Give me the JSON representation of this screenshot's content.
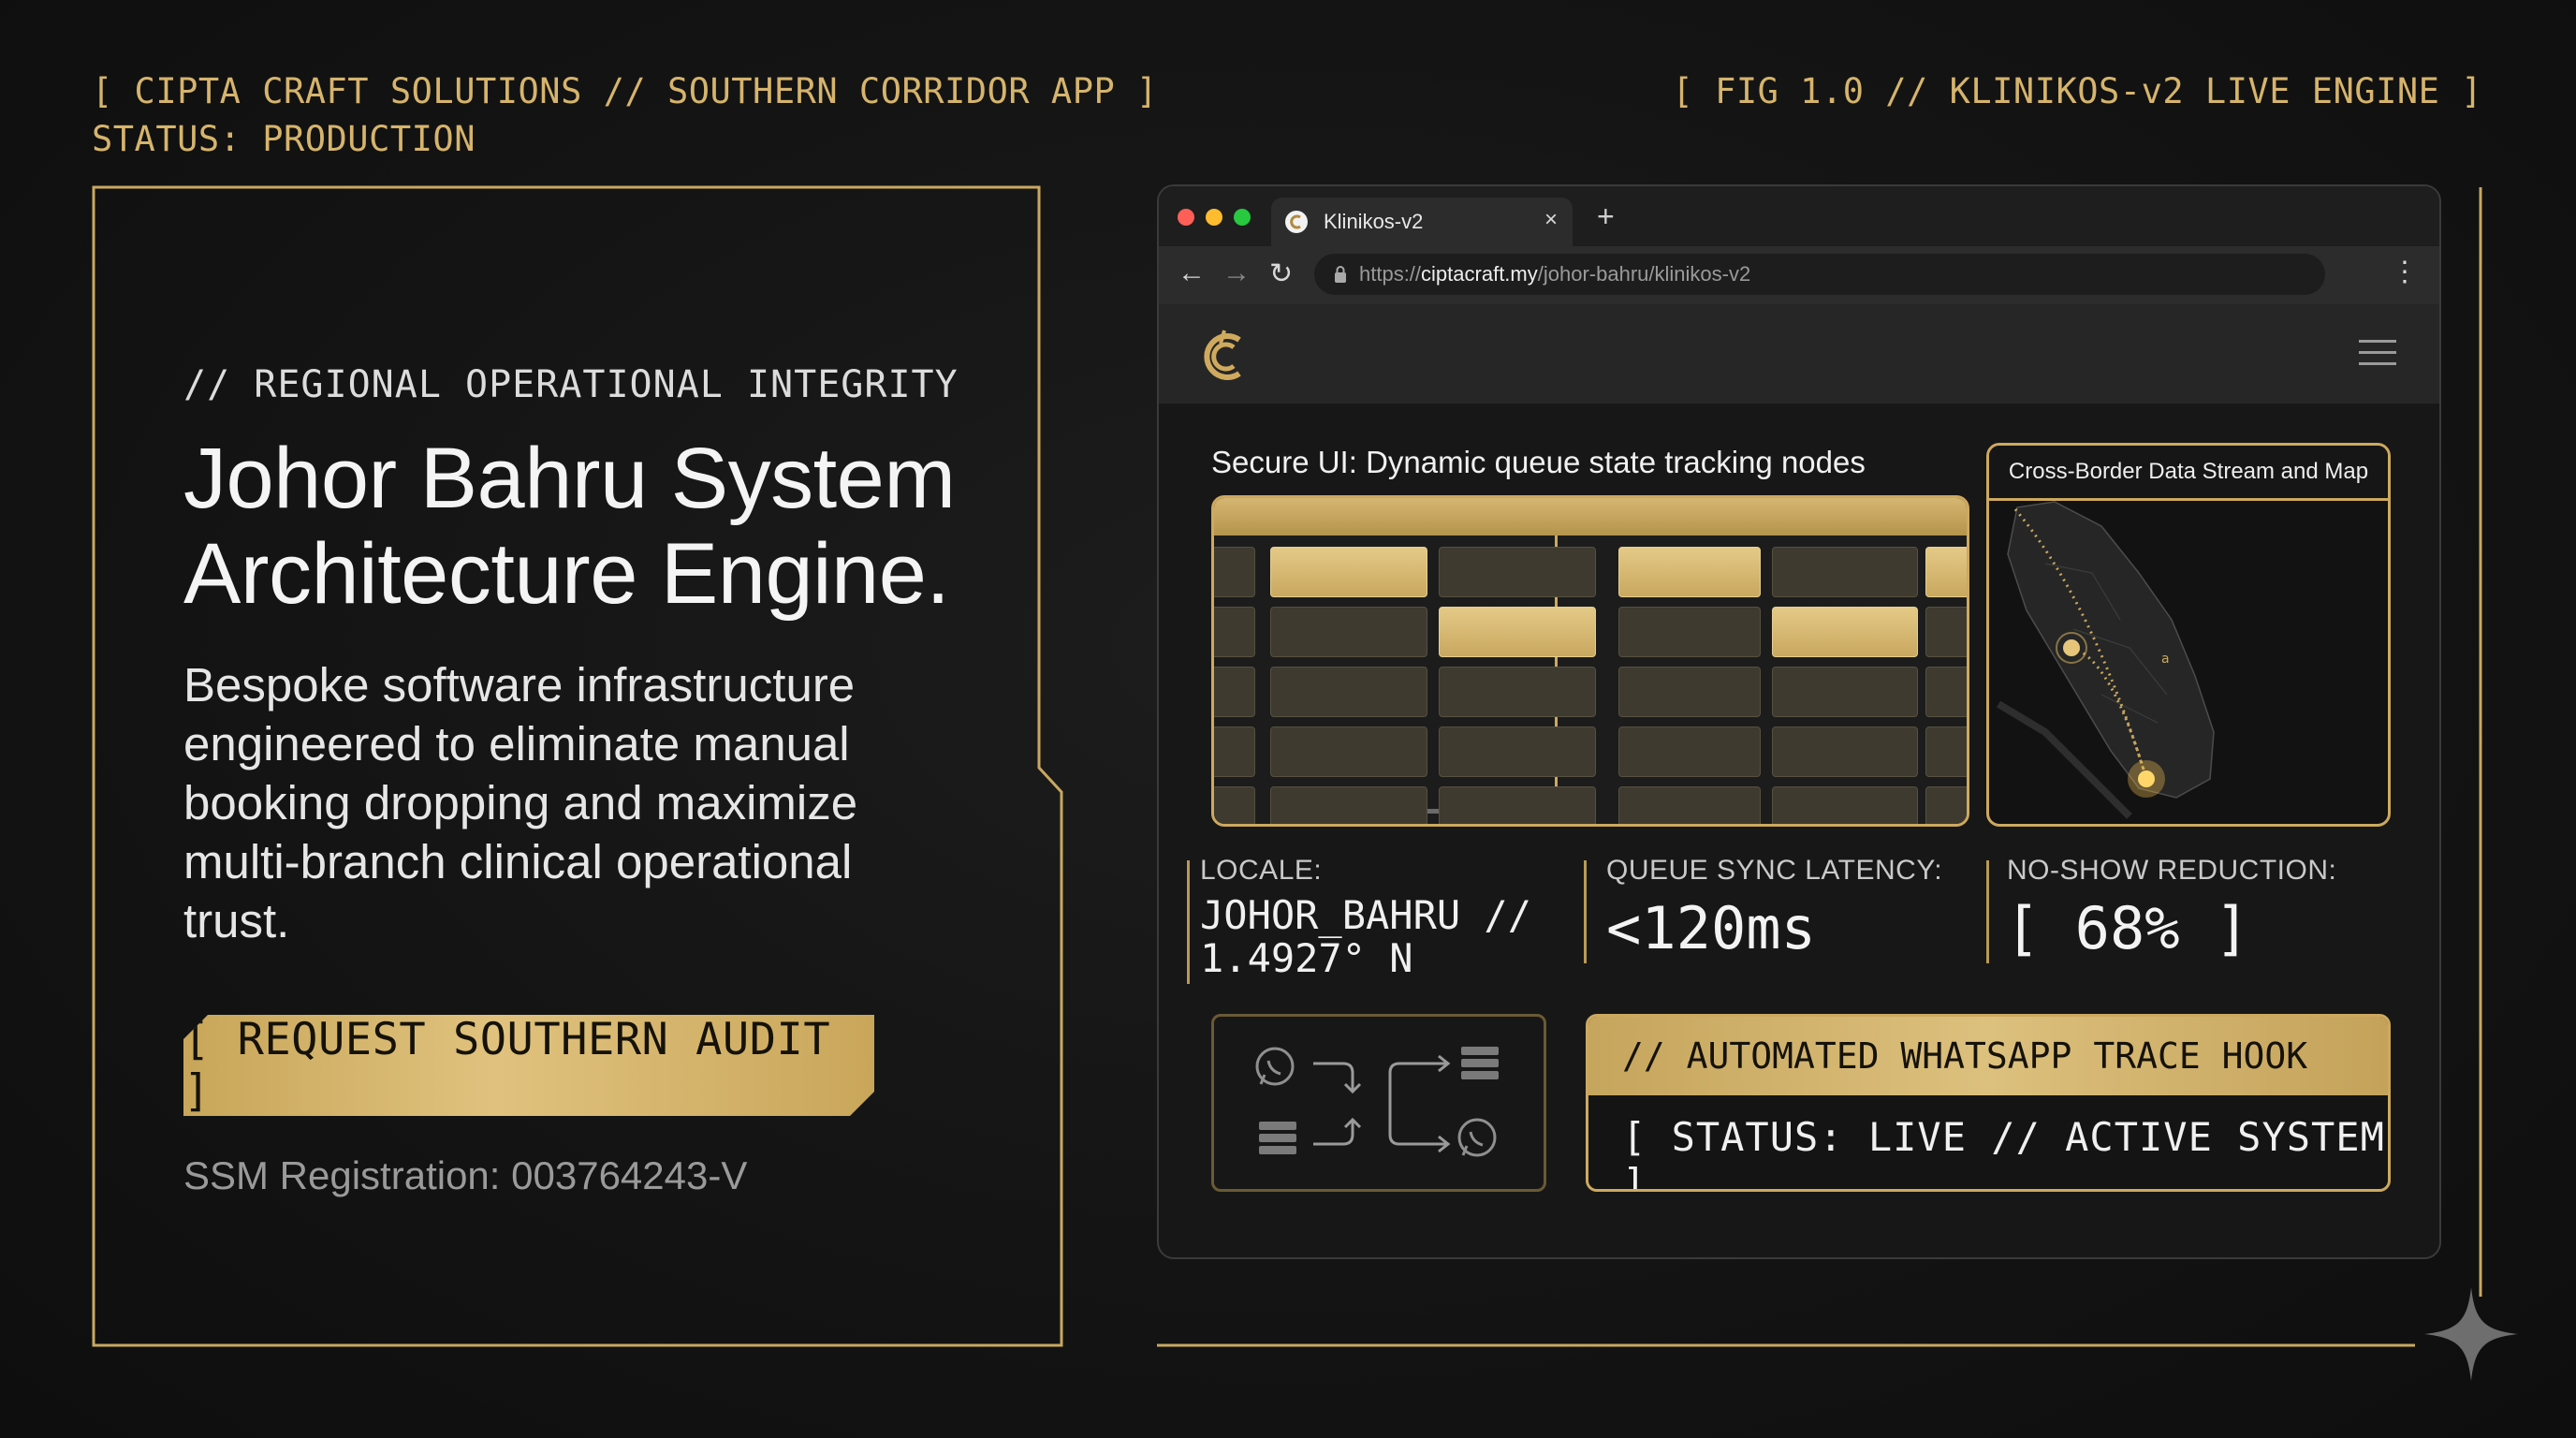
{
  "header": {
    "left_line1": "[ CIPTA CRAFT SOLUTIONS // SOUTHERN CORRIDOR APP ]",
    "left_line2": "STATUS: PRODUCTION",
    "right": "[ FIG 1.0 // KLINIKOS-v2 LIVE ENGINE ]"
  },
  "hero": {
    "kicker": "// REGIONAL OPERATIONAL INTEGRITY",
    "headline_line1": "Johor Bahru System",
    "headline_line2": "Architecture Engine.",
    "body_lines": [
      "Bespoke software infrastructure",
      "engineered to eliminate manual",
      "booking dropping and maximize",
      "multi-branch clinical operational",
      "trust."
    ],
    "cta_label": "[ REQUEST SOUTHERN AUDIT ]",
    "ssm": "SSM Registration: 003764243-V"
  },
  "browser": {
    "tab_title": "Klinikos-v2",
    "tab_close": "×",
    "new_tab": "+",
    "url_scheme": "https://",
    "url_host": "ciptacraft.my",
    "url_path": "/johor-bahru/klinikos-v2",
    "back": "←",
    "forward": "→",
    "reload": "↻",
    "menu": "⋮",
    "traffic_colors": [
      "#ff5f57",
      "#febc2e",
      "#28c840"
    ]
  },
  "app": {
    "queue_title": "Secure UI: Dynamic queue state tracking nodes",
    "map_title": "Cross-Border Data Stream and Map",
    "stats": [
      {
        "label": "LOCALE:",
        "value_line1": "JOHOR_BAHRU //",
        "value_line2": "1.4927° N"
      },
      {
        "label": "QUEUE SYNC LATENCY:",
        "value": "<120ms"
      },
      {
        "label": "NO-SHOW REDUCTION:",
        "value": "[ 68% ]"
      }
    ],
    "hook_title": "// AUTOMATED WHATSAPP TRACE HOOK",
    "hook_status": "[ STATUS: LIVE // ACTIVE SYSTEM ]"
  },
  "colors": {
    "accent_gold": "#d6b46c",
    "background": "#141414"
  },
  "icons": [
    "cipta-logo-icon",
    "whatsapp-icon",
    "server-icon",
    "flow-arrow-icon",
    "lock-icon",
    "hamburger-icon",
    "sparkle-icon"
  ]
}
